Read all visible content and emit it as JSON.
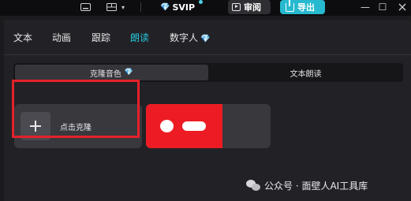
{
  "topbar": {
    "svip_label": "SVIP",
    "review_label": "审阅",
    "export_label": "导出",
    "minimize_glyph": "—",
    "maximize_glyph": "☐"
  },
  "tabs": [
    {
      "label": "文本"
    },
    {
      "label": "动画"
    },
    {
      "label": "跟踪"
    },
    {
      "label": "朗读"
    },
    {
      "label": "数字人"
    }
  ],
  "active_tab": "朗读",
  "segments": [
    {
      "label": "克隆音色",
      "active": true
    },
    {
      "label": "文本朗读",
      "active": false
    }
  ],
  "clone_card": {
    "label": "点击克隆"
  },
  "watermark": {
    "text": "公众号 · 面壁人AI工具库"
  },
  "colors": {
    "accent": "#27c6dc",
    "export_bg": "#27b9cf",
    "highlight": "#e4212b",
    "redaction": "#ed1c24"
  }
}
